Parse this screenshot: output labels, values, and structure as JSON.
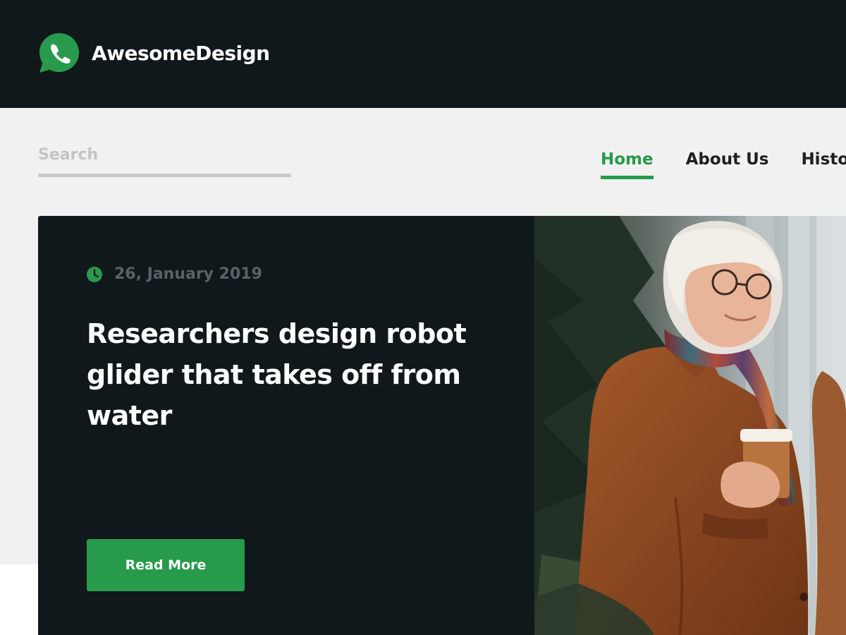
{
  "brand": {
    "name": "AwesomeDesign",
    "logo_icon": "whatsapp-phone-icon",
    "accent": "#279a4c"
  },
  "search": {
    "placeholder": "Search",
    "value": ""
  },
  "nav": {
    "items": [
      {
        "label": "Home",
        "active": true
      },
      {
        "label": "About Us",
        "active": false
      },
      {
        "label": "History",
        "active": false
      }
    ]
  },
  "hero": {
    "date": "26, January 2019",
    "date_icon": "clock-icon",
    "headline": "Researchers design robot glider that takes off from water",
    "button_label": "Read More",
    "photo_icon": "photo-elderly-woman-coffee"
  },
  "colors": {
    "header_bg": "#11181c",
    "page_bg": "#f1f1f1",
    "accent": "#279a4c"
  }
}
